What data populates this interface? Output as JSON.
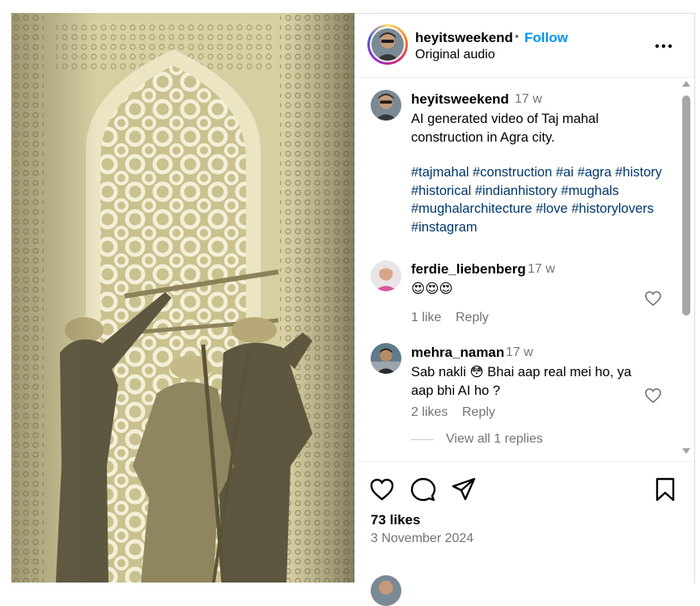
{
  "post": {
    "username": "heyitsweekend",
    "separator": "•",
    "follow_label": "Follow",
    "audio": "Original audio",
    "more_icon": "more-options-icon"
  },
  "caption": {
    "username": "heyitsweekend",
    "time": "17 w",
    "text": "AI generated video of Taj mahal construction in Agra city.",
    "hashtags": "#tajmahal #construction #ai #agra #history #historical #indianhistory #mughals #mughalarchitecture #love #historylovers #instagram"
  },
  "comments": [
    {
      "username": "ferdie_liebenberg",
      "time": "17 w",
      "text": "😍😍😍",
      "likes": "1 like",
      "reply_label": "Reply"
    },
    {
      "username": "mehra_naman",
      "time": "17 w",
      "text": "Sab nakli 😳 Bhai aap real mei ho, ya aap bhi AI ho ?",
      "likes": "2 likes",
      "reply_label": "Reply",
      "view_replies": "View all 1 replies"
    }
  ],
  "actions": {
    "icons": [
      "heart-icon",
      "comment-icon",
      "share-icon",
      "bookmark-icon"
    ],
    "likes": "73 likes",
    "date": "3 November 2024"
  },
  "colors": {
    "link": "#0095f6",
    "hashtag": "#00376b",
    "muted": "#737373"
  }
}
